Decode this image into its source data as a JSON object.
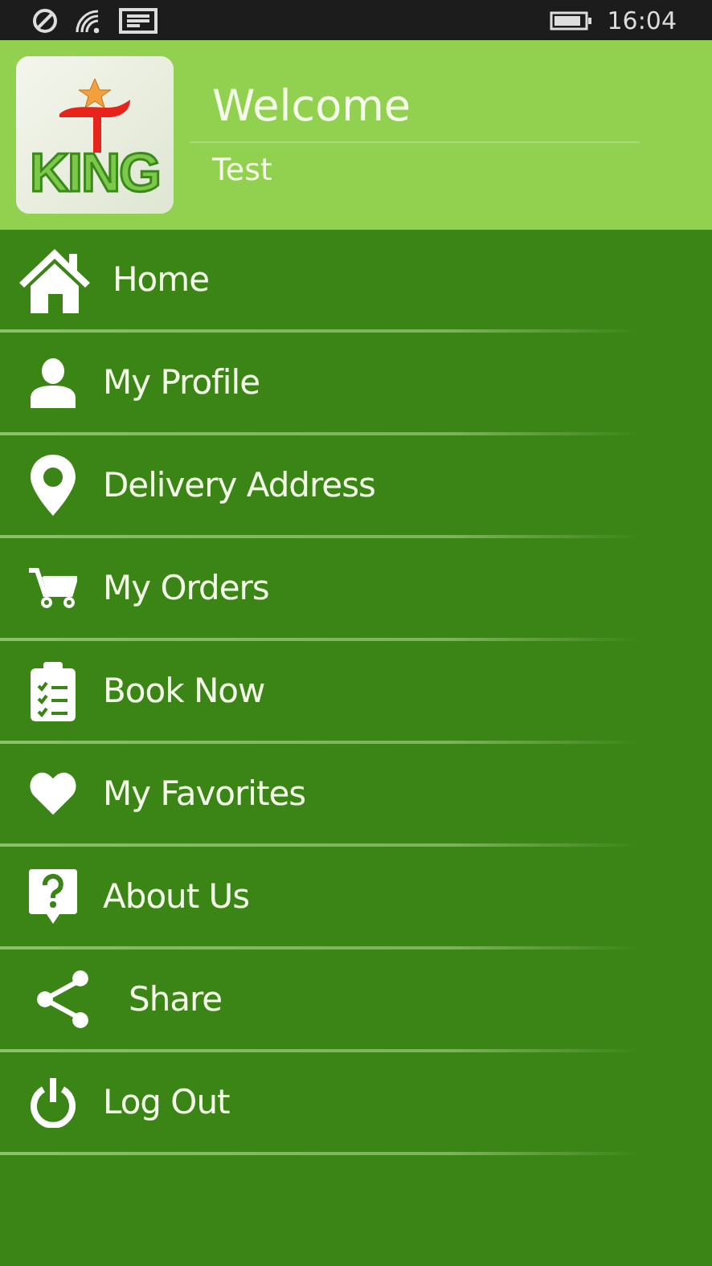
{
  "status_bar": {
    "time": "16:04"
  },
  "header": {
    "logo_text": "KING",
    "title": "Welcome",
    "subtitle": "Test"
  },
  "menu": [
    {
      "label": "Home"
    },
    {
      "label": "My Profile"
    },
    {
      "label": "Delivery Address"
    },
    {
      "label": "My Orders"
    },
    {
      "label": "Book Now"
    },
    {
      "label": "My Favorites"
    },
    {
      "label": "About Us"
    },
    {
      "label": "Share"
    },
    {
      "label": "Log Out"
    }
  ]
}
